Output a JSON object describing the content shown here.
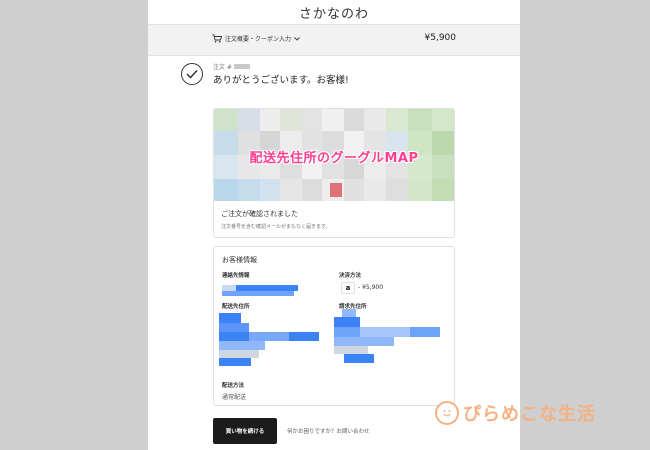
{
  "header": {
    "store_name": "さかなのわ"
  },
  "order_summary": {
    "toggle_label": "注文概要・クーポン入力",
    "total": "¥5,900",
    "cart_icon": "cart-icon",
    "chevron_icon": "chevron-down-icon"
  },
  "order": {
    "number_prefix": "注文 #",
    "thanks_message": "ありがとうございます。お客様!"
  },
  "map_card": {
    "overlay_label": "配送先住所のグーグルMAP",
    "confirm_title": "ご注文が確認されました",
    "confirm_sub": "注文番号を含む確認メールがまもなく届きます。"
  },
  "customer_info": {
    "heading": "お客様情報",
    "contact_label": "連絡先情報",
    "payment_label": "決済方法",
    "payment_icon_text": "a",
    "payment_amount": "- ¥5,900",
    "shipping_address_label": "配送先住所",
    "billing_address_label": "請求先住所",
    "shipping_method_label": "配送方法",
    "shipping_method_value": "通常配送"
  },
  "actions": {
    "continue_label": "買い物を続ける",
    "help_prefix": "何かお困りですか？",
    "help_link": "お問い合わせ"
  },
  "watermark": {
    "text": "ぴらめこな生活"
  },
  "colors": {
    "map_label": "#ff3f91",
    "redaction_blue": "#3b82f6",
    "button_bg": "#1c1c1c",
    "watermark": "#f4b183"
  }
}
